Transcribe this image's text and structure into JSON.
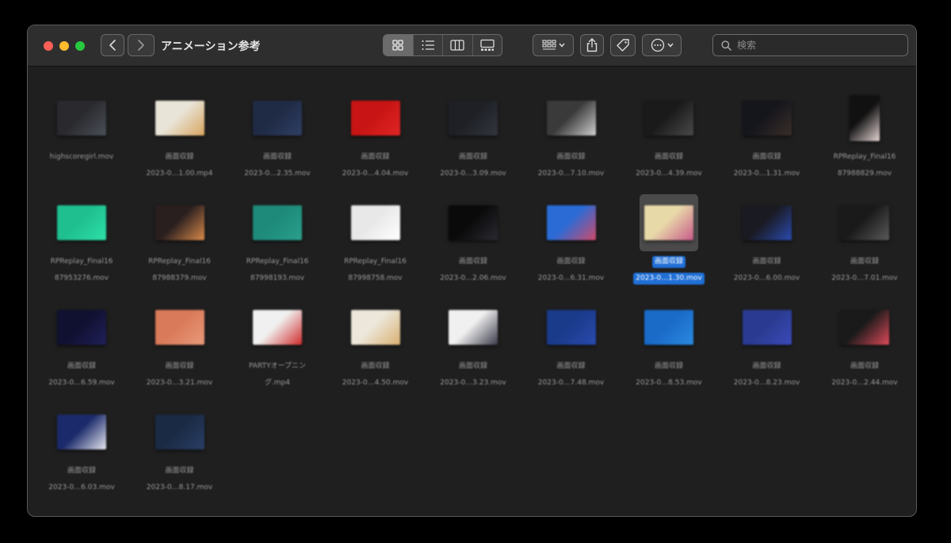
{
  "window": {
    "title": "アニメーション参考",
    "search_placeholder": "検索"
  },
  "toolbar": {
    "view_modes": [
      "icon",
      "list",
      "columns",
      "gallery"
    ],
    "active_view": "icon"
  },
  "files": [
    {
      "line1": "highscoregirl.mov",
      "line2": "",
      "colors": [
        "#2a2a2e",
        "#4a4f58"
      ]
    },
    {
      "line1": "画面収録",
      "line2": "2023-0…1.00.mp4",
      "colors": [
        "#e8e4d8",
        "#d9a55f"
      ]
    },
    {
      "line1": "画面収録",
      "line2": "2023-0…2.35.mov",
      "colors": [
        "#1f2a44",
        "#2f3f66"
      ]
    },
    {
      "line1": "画面収録",
      "line2": "2023-0…4.04.mov",
      "colors": [
        "#c81414",
        "#e02424"
      ]
    },
    {
      "line1": "画面収録",
      "line2": "2023-0…3.09.mov",
      "colors": [
        "#1e2026",
        "#34363e"
      ]
    },
    {
      "line1": "画面収録",
      "line2": "2023-0…7.10.mov",
      "colors": [
        "#3a3a3a",
        "#cfcfcf"
      ]
    },
    {
      "line1": "画面収録",
      "line2": "2023-0…4.39.mov",
      "colors": [
        "#1a1a1a",
        "#4a4a4a"
      ]
    },
    {
      "line1": "画面収録",
      "line2": "2023-0…1.31.mov",
      "colors": [
        "#15151c",
        "#3a2f2a"
      ]
    },
    {
      "line1": "RPReplay_Final16",
      "line2": "87988829.mov",
      "colors": [
        "#111",
        "#e8d6d6"
      ],
      "tall": true
    },
    {
      "line1": "RPReplay_Final16",
      "line2": "87953276.mov",
      "colors": [
        "#1fbf8f",
        "#2de0a8"
      ]
    },
    {
      "line1": "RPReplay_Final16",
      "line2": "87988379.mov",
      "colors": [
        "#2a1f1f",
        "#d98a4a"
      ]
    },
    {
      "line1": "RPReplay_Final16",
      "line2": "87998193.mov",
      "colors": [
        "#1e8a7a",
        "#2aa08c"
      ]
    },
    {
      "line1": "RPReplay_Final16",
      "line2": "87998758.mov",
      "colors": [
        "#e8e8e8",
        "#ffffff"
      ]
    },
    {
      "line1": "画面収録",
      "line2": "2023-0…2.06.mov",
      "colors": [
        "#0a0a0a",
        "#2a2a32"
      ]
    },
    {
      "line1": "画面収録",
      "line2": "2023-0…6.31.mov",
      "colors": [
        "#2a6bd6",
        "#d04a6a"
      ]
    },
    {
      "line1": "画面収録",
      "line2": "2023-0…1.30.mov",
      "colors": [
        "#e8d9a8",
        "#c85a8a"
      ],
      "selected": true
    },
    {
      "line1": "画面収録",
      "line2": "2023-0…6.00.mov",
      "colors": [
        "#1a1a22",
        "#2a4ab0"
      ]
    },
    {
      "line1": "画面収録",
      "line2": "2023-0…7.01.mov",
      "colors": [
        "#1a1a1a",
        "#5a5a5a"
      ]
    },
    {
      "line1": "画面収録",
      "line2": "2023-0…6.59.mov",
      "colors": [
        "#101030",
        "#20205a"
      ]
    },
    {
      "line1": "画面収録",
      "line2": "2023-0…3.21.mov",
      "colors": [
        "#d97a5a",
        "#e89a7a"
      ]
    },
    {
      "line1": "PARTYオープニン",
      "line2": "グ.mp4",
      "colors": [
        "#f0f0f0",
        "#d02a2a"
      ]
    },
    {
      "line1": "画面収録",
      "line2": "2023-0…4.50.mov",
      "colors": [
        "#ece7da",
        "#d9b070"
      ]
    },
    {
      "line1": "画面収録",
      "line2": "2023-0…3.23.mov",
      "colors": [
        "#f0f0f0",
        "#3a3a4a"
      ]
    },
    {
      "line1": "画面収録",
      "line2": "2023-0…7.48.mov",
      "colors": [
        "#1a3a8a",
        "#2a4ab0"
      ]
    },
    {
      "line1": "画面収録",
      "line2": "2023-0…8.53.mov",
      "colors": [
        "#1a6ac8",
        "#2a8ae0"
      ]
    },
    {
      "line1": "画面収録",
      "line2": "2023-0…8.23.mov",
      "colors": [
        "#2a3a90",
        "#3a4ab8"
      ]
    },
    {
      "line1": "画面収録",
      "line2": "2023-0…2.44.mov",
      "colors": [
        "#1a1a1a",
        "#e04a5a"
      ]
    },
    {
      "line1": "画面収録",
      "line2": "2023-0…6.03.mov",
      "colors": [
        "#1a2a6a",
        "#e8e8f0"
      ]
    },
    {
      "line1": "画面収録",
      "line2": "2023-0…8.17.mov",
      "colors": [
        "#1a2a44",
        "#2a3f66"
      ]
    }
  ]
}
